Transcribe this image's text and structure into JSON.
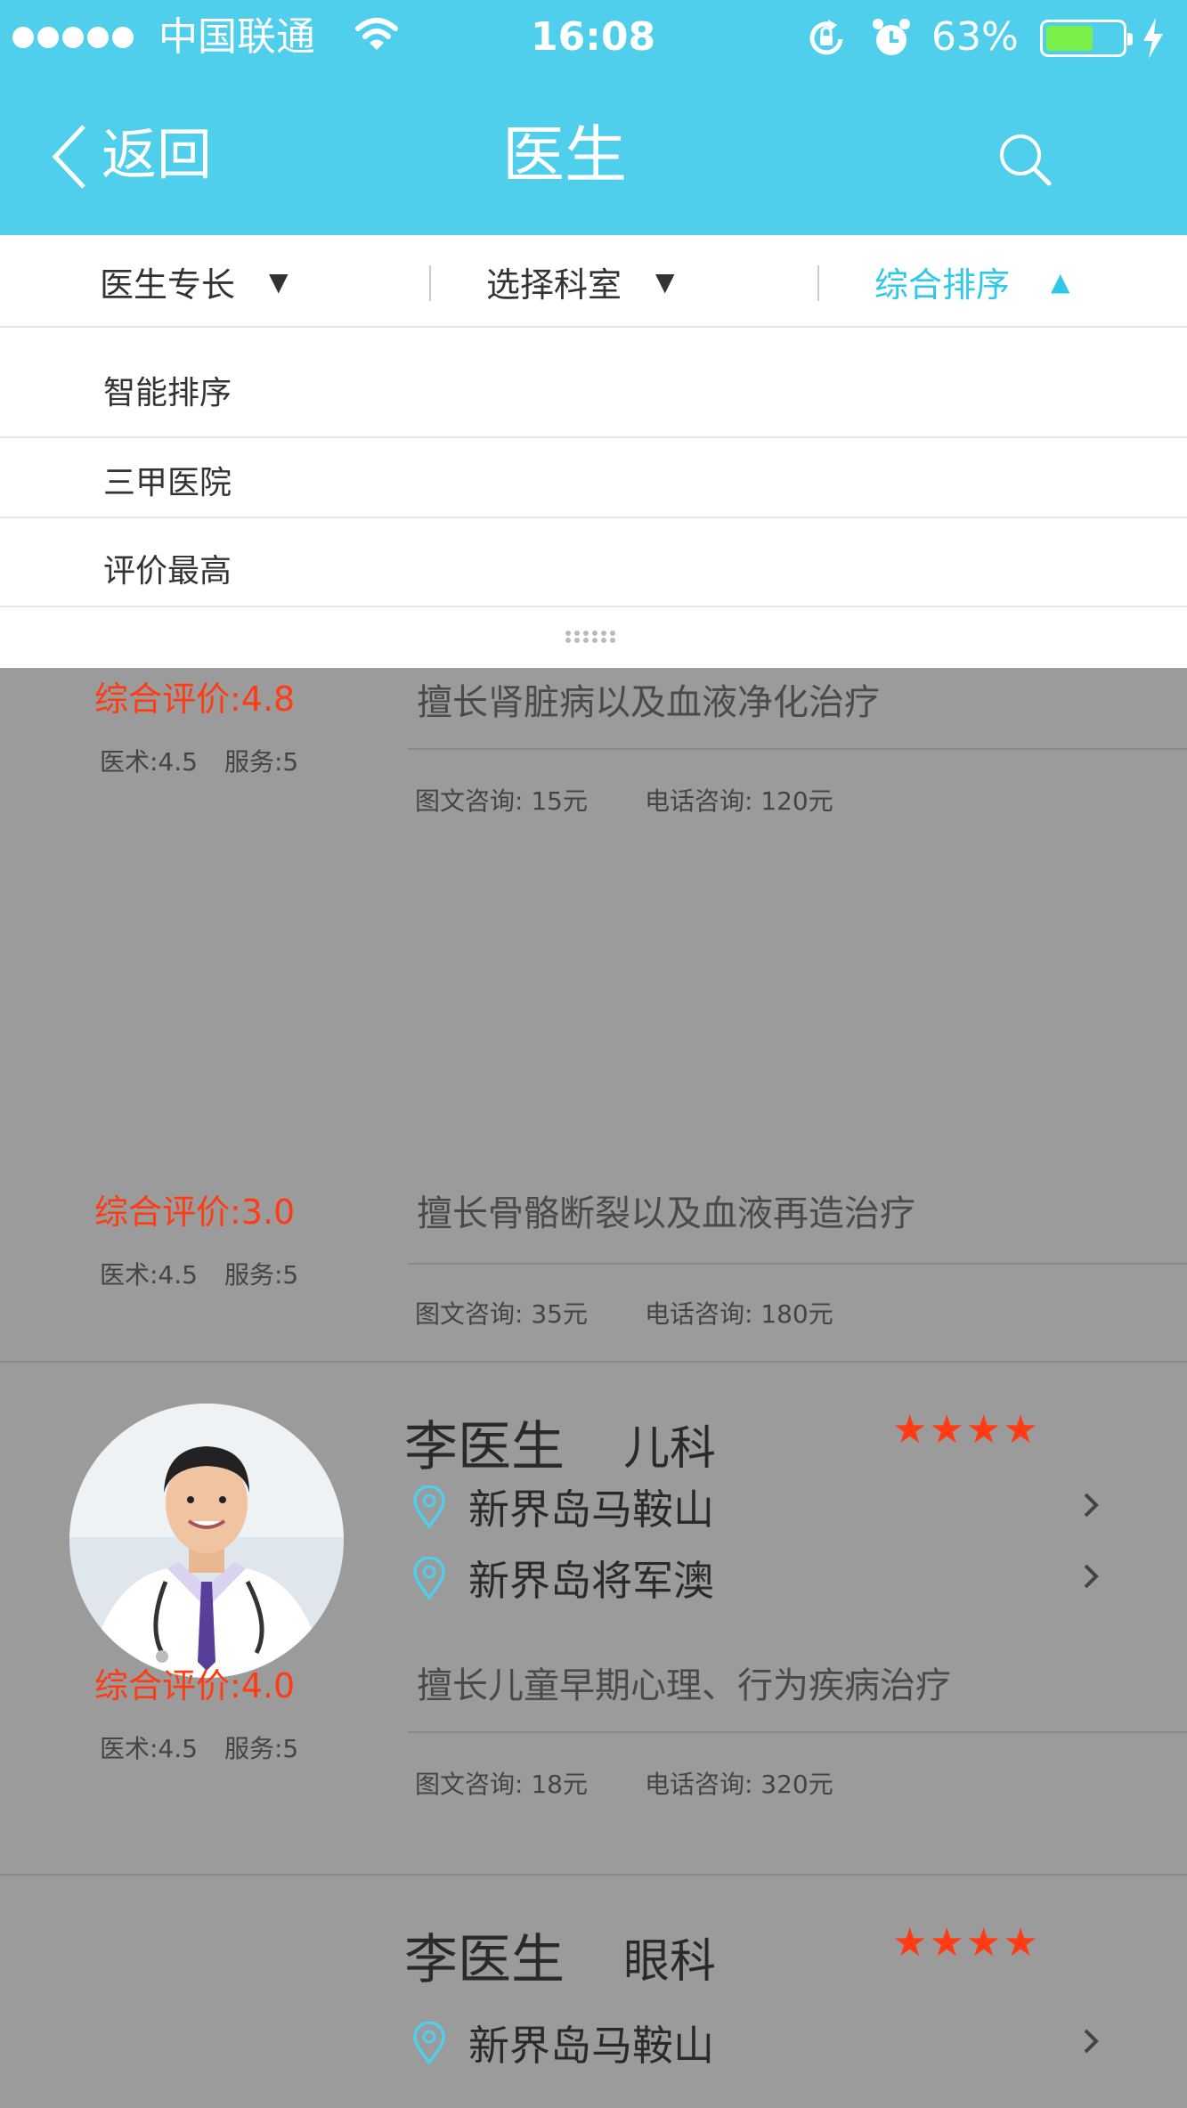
{
  "status_bar": {
    "carrier": "中国联通",
    "time": "16:08",
    "battery_percent_label": "63%",
    "battery_level": 0.63,
    "signal_dots": 5
  },
  "nav": {
    "back_label": "返回",
    "title": "医生"
  },
  "filters": [
    {
      "label": "医生专长",
      "arrow": "▼"
    },
    {
      "label": "选择科室",
      "arrow": "▼"
    },
    {
      "label": "综合排序",
      "arrow": "▲"
    }
  ],
  "sort_menu": {
    "items": [
      "智能排序",
      "三甲医院",
      "评价最高"
    ]
  },
  "doctors": [
    {
      "rating": "综合评价:4.8",
      "medical": "医术:4.5",
      "service": "服务:5",
      "specialty": "擅长肾脏病以及血液净化治疗",
      "text_consult": "图文咨询: 15元",
      "phone_consult": "电话咨询: 120元"
    },
    {
      "rating": "综合评价:3.0",
      "medical": "医术:4.5",
      "service": "服务:5",
      "specialty": "擅长骨骼断裂以及血液再造治疗",
      "text_consult": "图文咨询: 35元",
      "phone_consult": "电话咨询: 180元"
    },
    {
      "name": "李医生",
      "department": "儿科",
      "stars": "★★★★",
      "star_count": 4,
      "locations": [
        "新界岛马鞍山",
        "新界岛将军澳"
      ],
      "rating": "综合评价:4.0",
      "medical": "医术:4.5",
      "service": "服务:5",
      "specialty": "擅长儿童早期心理、行为疾病治疗",
      "text_consult": "图文咨询: 18元",
      "phone_consult": "电话咨询: 320元"
    },
    {
      "name": "李医生",
      "department": "眼科",
      "stars": "★★★★",
      "star_count": 4,
      "locations": [
        "新界岛马鞍山"
      ]
    }
  ],
  "colors": {
    "header_bg": "#4fcfec",
    "active_filter": "#2fc8e8",
    "rating_red": "#ff3b14",
    "overlay_gray": "#9b9b9b",
    "battery_green": "#7cf04a"
  },
  "icons": {
    "back": "chevron-left-icon",
    "search": "search-icon",
    "wifi": "wifi-icon",
    "rotation_lock": "rotation-lock-icon",
    "alarm": "alarm-icon",
    "charging": "lightning-icon",
    "location": "location-pin-icon",
    "chevron": "chevron-right-icon",
    "grip": "drag-handle-icon"
  }
}
